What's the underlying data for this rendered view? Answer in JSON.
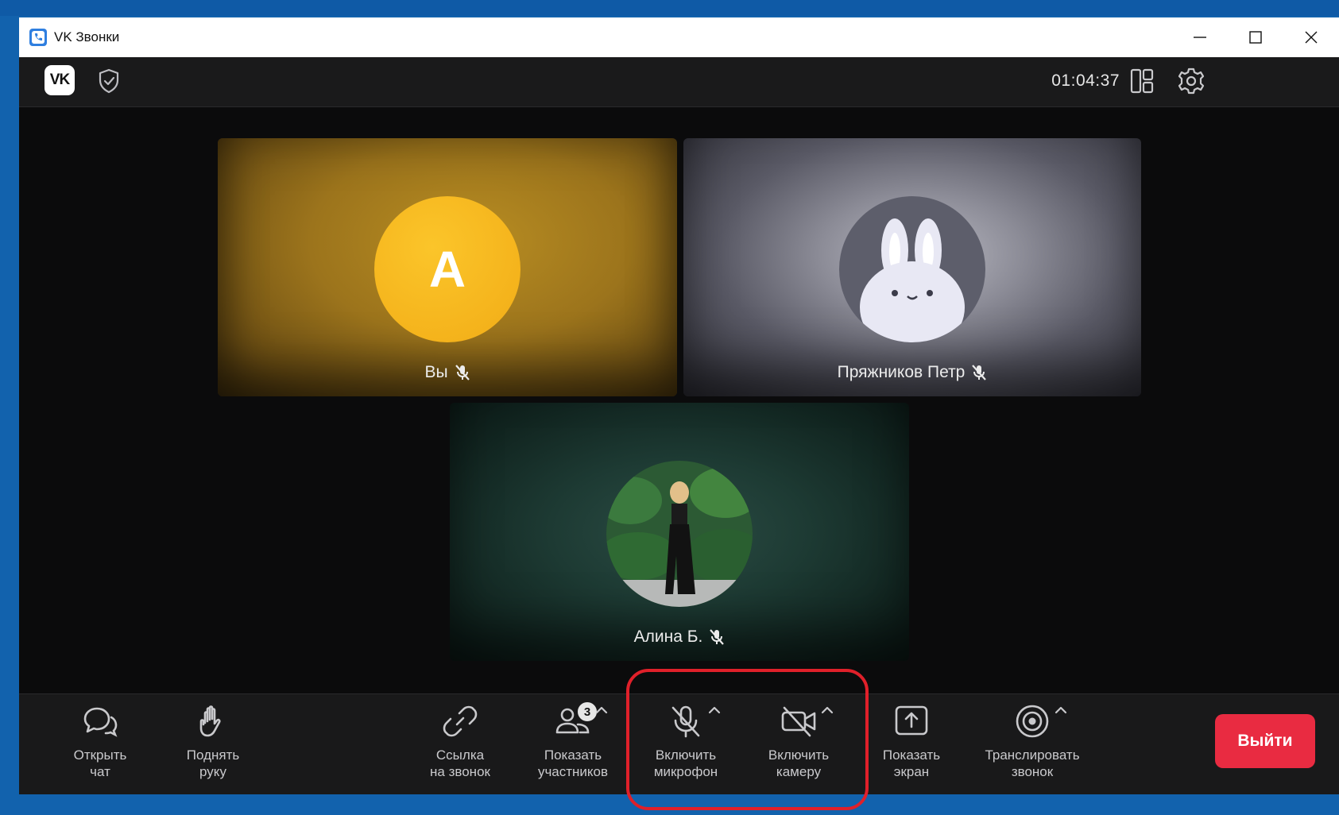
{
  "window": {
    "title": "VK Звонки",
    "controls": [
      "minimize",
      "maximize",
      "close"
    ]
  },
  "header": {
    "logo_text": "VK",
    "timer": "01:04:37"
  },
  "participants": [
    {
      "name": "Вы",
      "avatar_letter": "А",
      "avatar_color": "#f5b51d",
      "muted": true
    },
    {
      "name": "Пряжников Петр",
      "avatar": "rabbit",
      "muted": true
    },
    {
      "name": "Алина Б.",
      "avatar": "photo",
      "muted": true
    }
  ],
  "toolbar": {
    "chat": {
      "line1": "Открыть",
      "line2": "чат"
    },
    "hand": {
      "line1": "Поднять",
      "line2": "руку"
    },
    "link": {
      "line1": "Ссылка",
      "line2": "на звонок"
    },
    "participants": {
      "line1": "Показать",
      "line2": "участников",
      "badge": "3"
    },
    "mic": {
      "line1": "Включить",
      "line2": "микрофон"
    },
    "camera": {
      "line1": "Включить",
      "line2": "камеру"
    },
    "screen": {
      "line1": "Показать",
      "line2": "экран"
    },
    "broadcast": {
      "line1": "Транслировать",
      "line2": "звонок"
    },
    "exit": "Выйти"
  },
  "colors": {
    "exit_button": "#e92b41",
    "highlight": "#e0202a",
    "background": "#0b0b0c"
  }
}
